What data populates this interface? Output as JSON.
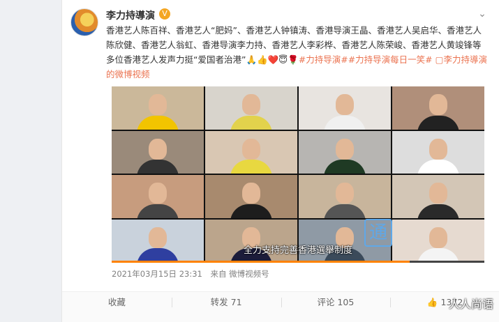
{
  "post": {
    "author": "李力持導演",
    "verified_icon": "V",
    "more_icon": "chevron-down-icon",
    "text_prefix": "香港艺人陈百祥、香港艺人“肥妈”、香港艺人钟镇涛、香港导演王晶、香港艺人吴启华、香港艺人陈欣健、香港艺人翁虹、香港导演李力持、香港艺人李彩桦、香港艺人陈荣峻、香港艺人黄竣锋等多位香港艺人发声力挺“爱国者治港”🙏👍❤️😇🌹",
    "hashtag1": "#力持导演#",
    "hashtag2": "#力持导演每日一笑#",
    "video_link": "▢李力持導演的微博视频",
    "video_caption": "全力支持完善香港選舉制度",
    "video_watermark": "通",
    "progress": 0.8,
    "timestamp": "2021年03月15日 23:31",
    "source": "来自 微博视频号"
  },
  "actions": {
    "favorite": "收藏",
    "repost": "转发 71",
    "comment": "评论 105",
    "like": "1372"
  },
  "overlay_watermark": "人人尚语",
  "colors": {
    "link": "#eb7350",
    "progress": "#ff8200"
  }
}
